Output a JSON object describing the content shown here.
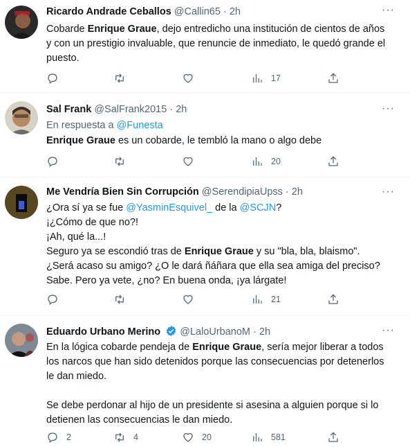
{
  "tweets": [
    {
      "name": "Ricardo Andrade Ceballos",
      "handle": "@Callin65",
      "dot": "·",
      "time": "2h",
      "text": [
        "Cobarde ",
        "Enrique Graue",
        ", dejo entredicho una institución de cientos de años y con un prestigio invaluable, que renuncie de inmediato, le quedó grande el puesto."
      ],
      "counts": {
        "reply": "",
        "retweet": "",
        "like": "",
        "views": "17"
      }
    },
    {
      "name": "Sal Frank",
      "handle": "@SalFrank2015",
      "dot": "·",
      "time": "2h",
      "reply_prefix": "En respuesta a ",
      "reply_to": "@Funesta",
      "text": [
        "Enrique Graue",
        " es un cobarde, le tembló la mano o algo debe"
      ],
      "counts": {
        "reply": "",
        "retweet": "",
        "like": "",
        "views": "20"
      }
    },
    {
      "name": "Me Vendría Bien Sin Corrupción",
      "handle": "@SerendipiaUpss",
      "dot": "·",
      "time": "2h",
      "text": {
        "l1a": "¿Ora sí ya se fue ",
        "l1b": "@YasminEsquivel_",
        "l1c": " de la ",
        "l1d": "@SCJN",
        "l1e": "?",
        "l2": "¡¿Cómo de que no?!",
        "l3": "¡Ah, qué la...!",
        "l4a": "Seguro ya se escondió tras de ",
        "l4b": "Enrique Graue",
        "l4c": " y su \"bla, bla, blaismo\". ¿Será acaso su amigo? ¿O le dará ñáñara que ella sea amiga del preciso?",
        "l5": "Sabe. Pero ya vete, ¿no? En buena onda, ¡ya lárgate!"
      },
      "counts": {
        "reply": "",
        "retweet": "",
        "like": "",
        "views": "21"
      }
    },
    {
      "name": "Eduardo Urbano Merino",
      "handle": "@LaloUrbanoM",
      "dot": "·",
      "time": "2h",
      "text": {
        "p1a": "En la lógica cobarde pendeja de ",
        "p1b": "Enrique Graue",
        "p1c": ", sería mejor liberar a todos los narcos que han sido detenidos porque las consecuencias por detenerlos le dan miedo.",
        "p2": "Se debe perdonar al hijo de un presidente si asesina a alguien porque si lo detienen las consecuencias le dan miedo."
      },
      "counts": {
        "reply": "2",
        "retweet": "4",
        "like": "20",
        "views": "581"
      }
    }
  ],
  "more_label": "···",
  "colors": {
    "accent": "#1d9bf0",
    "muted": "#536471",
    "text": "#0f1419",
    "verified": "#1d9bf0"
  }
}
